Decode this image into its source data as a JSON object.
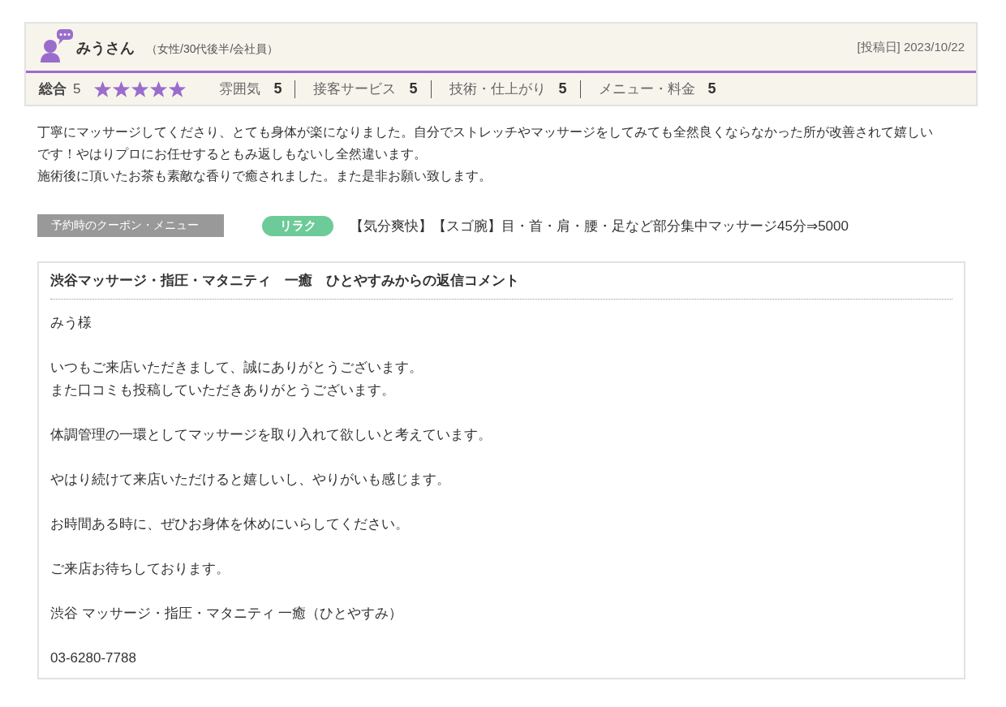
{
  "reviewer": {
    "name": "みうさん",
    "profile": "（女性/30代後半/会社員）",
    "posted": "[投稿日] 2023/10/22"
  },
  "ratings": {
    "overall_label": "総合",
    "overall_value": "5",
    "stars": 5,
    "items": [
      {
        "label": "雰囲気",
        "value": "5"
      },
      {
        "label": "接客サービス",
        "value": "5"
      },
      {
        "label": "技術・仕上がり",
        "value": "5"
      },
      {
        "label": "メニュー・料金",
        "value": "5"
      }
    ]
  },
  "review_body": [
    "丁寧にマッサージしてくださり、とても身体が楽になりました。自分でストレッチやマッサージをしてみても全然良くならなかった所が改善されて嬉しいです！やはりプロにお任せするともみ返しもないし全然違います。",
    "施術後に頂いたお茶も素敵な香りで癒されました。また是非お願い致します。"
  ],
  "coupon": {
    "label": "予約時のクーポン・メニュー",
    "tag": "リラク",
    "text": "【気分爽快】【スゴ腕】目・首・肩・腰・足など部分集中マッサージ45分⇒5000"
  },
  "reply": {
    "title": "渋谷マッサージ・指圧・マタニティ　一癒　ひとやすみからの返信コメント",
    "paragraphs": [
      [
        "みう様"
      ],
      [
        "いつもご来店いただきまして、誠にありがとうございます。",
        "また口コミも投稿していただきありがとうございます。"
      ],
      [
        "体調管理の一環としてマッサージを取り入れて欲しいと考えています。"
      ],
      [
        "やはり続けて来店いただけると嬉しいし、やりがいも感じます。"
      ],
      [
        "お時間ある時に、ぜひお身体を休めにいらしてください。"
      ],
      [
        "ご来店お待ちしております。"
      ],
      [
        "渋谷 マッサージ・指圧・マタニティ 一癒（ひとやすみ）"
      ],
      [
        "03-6280-7788"
      ]
    ]
  }
}
